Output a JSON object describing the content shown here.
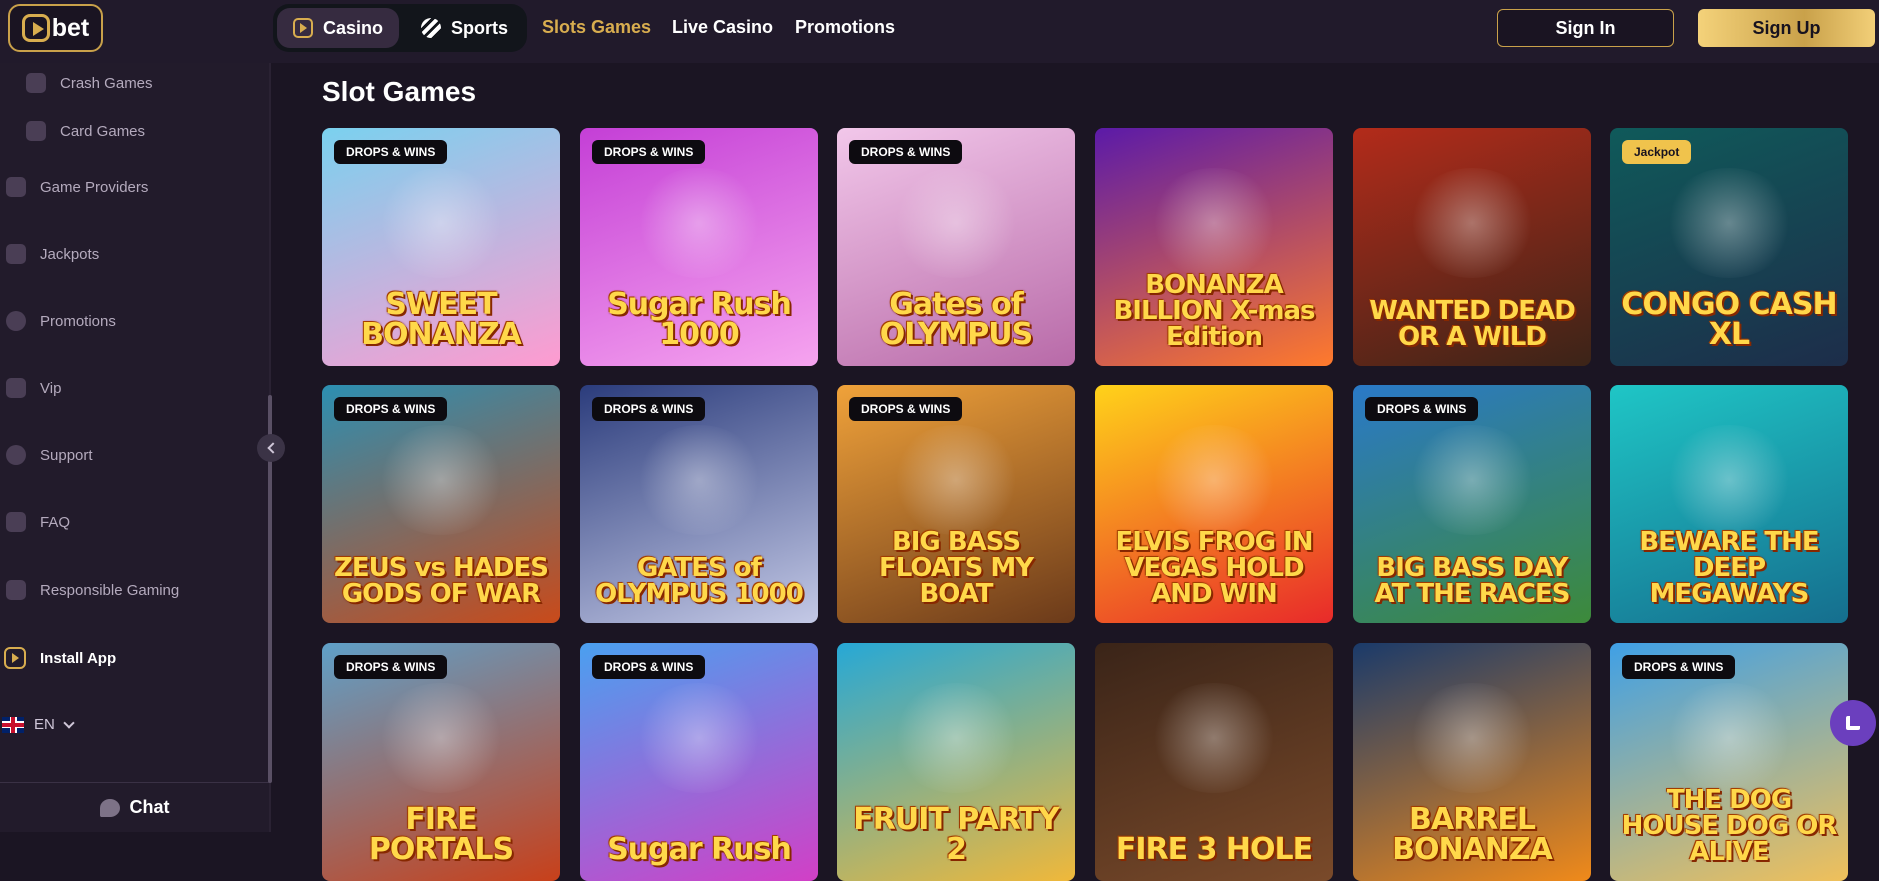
{
  "header": {
    "logo_text": "bet",
    "modes": [
      {
        "label": "Casino",
        "active": true,
        "icon": "casino-icon"
      },
      {
        "label": "Sports",
        "active": false,
        "icon": "sports-icon"
      }
    ],
    "nav": [
      {
        "label": "Slots Games",
        "active": true
      },
      {
        "label": "Live Casino",
        "active": false
      },
      {
        "label": "Promotions",
        "active": false
      }
    ],
    "sign_in": "Sign In",
    "sign_up": "Sign Up"
  },
  "sidebar": {
    "items": [
      {
        "label": "Crash Games",
        "icon": "crash-icon"
      },
      {
        "label": "Card Games",
        "icon": "cards-icon"
      },
      {
        "label": "Game Providers",
        "icon": "providers-icon"
      },
      {
        "label": "Jackpots",
        "icon": "jackpot-icon"
      },
      {
        "label": "Promotions",
        "icon": "promotions-icon"
      },
      {
        "label": "Vip",
        "icon": "diamond-icon"
      },
      {
        "label": "Support",
        "icon": "support-icon"
      },
      {
        "label": "FAQ",
        "icon": "chat-bubbles-icon"
      },
      {
        "label": "Responsible Gaming",
        "icon": "lock-icon"
      }
    ],
    "install": "Install App",
    "language": "EN",
    "chat": "Chat"
  },
  "main": {
    "title": "Slot Games",
    "games": [
      {
        "name": "SWEET BONANZA",
        "badge": "DROPS & WINS",
        "colors": [
          "#7ad1ef",
          "#ff9bd0"
        ]
      },
      {
        "name": "Sugar Rush 1000",
        "badge": "DROPS & WINS",
        "colors": [
          "#c43fd6",
          "#f6a4ef"
        ]
      },
      {
        "name": "Gates of OLYMPUS",
        "badge": "DROPS & WINS",
        "colors": [
          "#f2c7ea",
          "#b86aa8"
        ]
      },
      {
        "name": "BONANZA BILLION X-mas Edition",
        "badge": "",
        "colors": [
          "#5b1aa8",
          "#ff7a2c"
        ]
      },
      {
        "name": "WANTED DEAD OR A WILD",
        "badge": "",
        "colors": [
          "#b32b1a",
          "#3b2418"
        ]
      },
      {
        "name": "CONGO CASH XL",
        "badge": "Jackpot",
        "colors": [
          "#0f5a5a",
          "#1d2d4a"
        ]
      },
      {
        "name": "ZEUS vs HADES GODS OF WAR",
        "badge": "DROPS & WINS",
        "colors": [
          "#2c8fb2",
          "#c94a1a"
        ]
      },
      {
        "name": "GATES of OLYMPUS 1000",
        "badge": "DROPS & WINS",
        "colors": [
          "#2b3c7c",
          "#c4c9e6"
        ]
      },
      {
        "name": "BIG BASS FLOATS MY BOAT",
        "badge": "DROPS & WINS",
        "colors": [
          "#f0a23a",
          "#6b3a1a"
        ]
      },
      {
        "name": "ELVIS FROG IN VEGAS HOLD AND WIN",
        "badge": "",
        "colors": [
          "#ffd21a",
          "#e82a2a"
        ]
      },
      {
        "name": "BIG BASS DAY AT THE RACES",
        "badge": "DROPS & WINS",
        "colors": [
          "#2a79c8",
          "#3d8a3a"
        ]
      },
      {
        "name": "BEWARE THE DEEP MEGAWAYS",
        "badge": "",
        "colors": [
          "#1fc6c6",
          "#156e8e"
        ]
      },
      {
        "name": "FIRE PORTALS",
        "badge": "DROPS & WINS",
        "colors": [
          "#5fa0c8",
          "#c8401a"
        ]
      },
      {
        "name": "Sugar Rush",
        "badge": "DROPS & WINS",
        "colors": [
          "#4aa0f0",
          "#d23fc6"
        ]
      },
      {
        "name": "FRUIT PARTY 2",
        "badge": "",
        "colors": [
          "#26a8d6",
          "#f0b83a"
        ]
      },
      {
        "name": "FIRE 3 HOLE",
        "badge": "",
        "colors": [
          "#3a2418",
          "#7a4a2a"
        ]
      },
      {
        "name": "BARREL BONANZA",
        "badge": "",
        "colors": [
          "#1a3a6a",
          "#f08a1a"
        ]
      },
      {
        "name": "THE DOG HOUSE DOG OR ALIVE",
        "badge": "DROPS & WINS",
        "colors": [
          "#3fa0e6",
          "#f0c05a"
        ]
      }
    ]
  }
}
